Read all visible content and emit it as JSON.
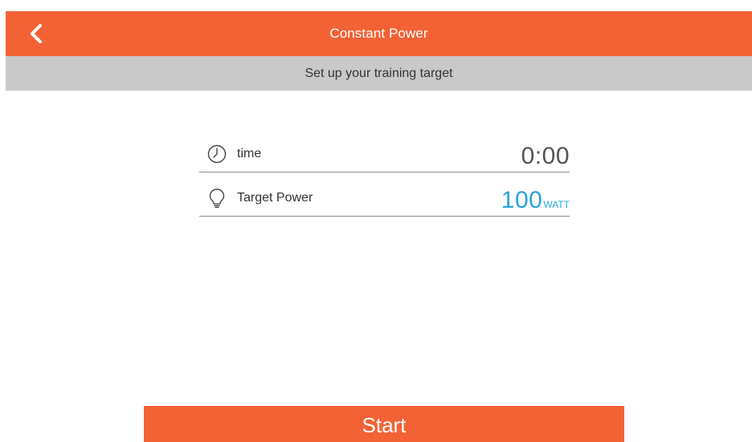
{
  "header": {
    "title": "Constant Power",
    "back_icon": "chevron-left-icon",
    "color": "#f26235"
  },
  "subheader": {
    "text": "Set up your training target",
    "color": "#c9c9c9"
  },
  "settings": {
    "time": {
      "icon": "clock-icon",
      "label": "time",
      "value": "0:00"
    },
    "target_power": {
      "icon": "lightbulb-icon",
      "label": "Target Power",
      "value": "100",
      "unit": "WATT",
      "value_color": "#2aa4dd"
    }
  },
  "footer": {
    "start_label": "Start",
    "color": "#f26235"
  }
}
